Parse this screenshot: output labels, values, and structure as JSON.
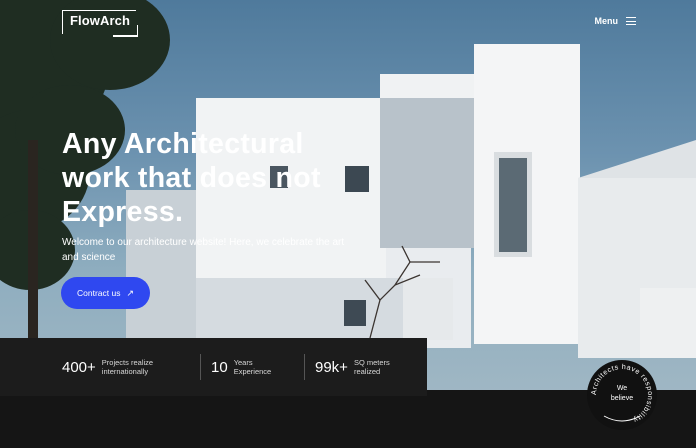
{
  "header": {
    "logo": "FlowArch",
    "menu_label": "Menu"
  },
  "hero": {
    "headline_lines": [
      "Any Architectural",
      "work that does not",
      "Express."
    ],
    "subtitle_lines": [
      "Welcome to our architecture website! Here, we celebrate the art",
      "and science"
    ],
    "cta_label": "Contract us",
    "cta_icon": "arrow-up-right-icon"
  },
  "stats": [
    {
      "value": "400+",
      "label_lines": [
        "Projects realize",
        "internationally"
      ]
    },
    {
      "value": "10",
      "label_lines": [
        "Years",
        "Experience"
      ]
    },
    {
      "value": "99k+",
      "label_lines": [
        "SQ meters",
        "realized"
      ]
    }
  ],
  "badge": {
    "ring_text": "Architects have responsibility",
    "center_lines": [
      "We",
      "believe"
    ]
  },
  "colors": {
    "accent": "#2f48f0",
    "stats_bg": "#1c1c1c",
    "footer_bg": "#151515"
  }
}
